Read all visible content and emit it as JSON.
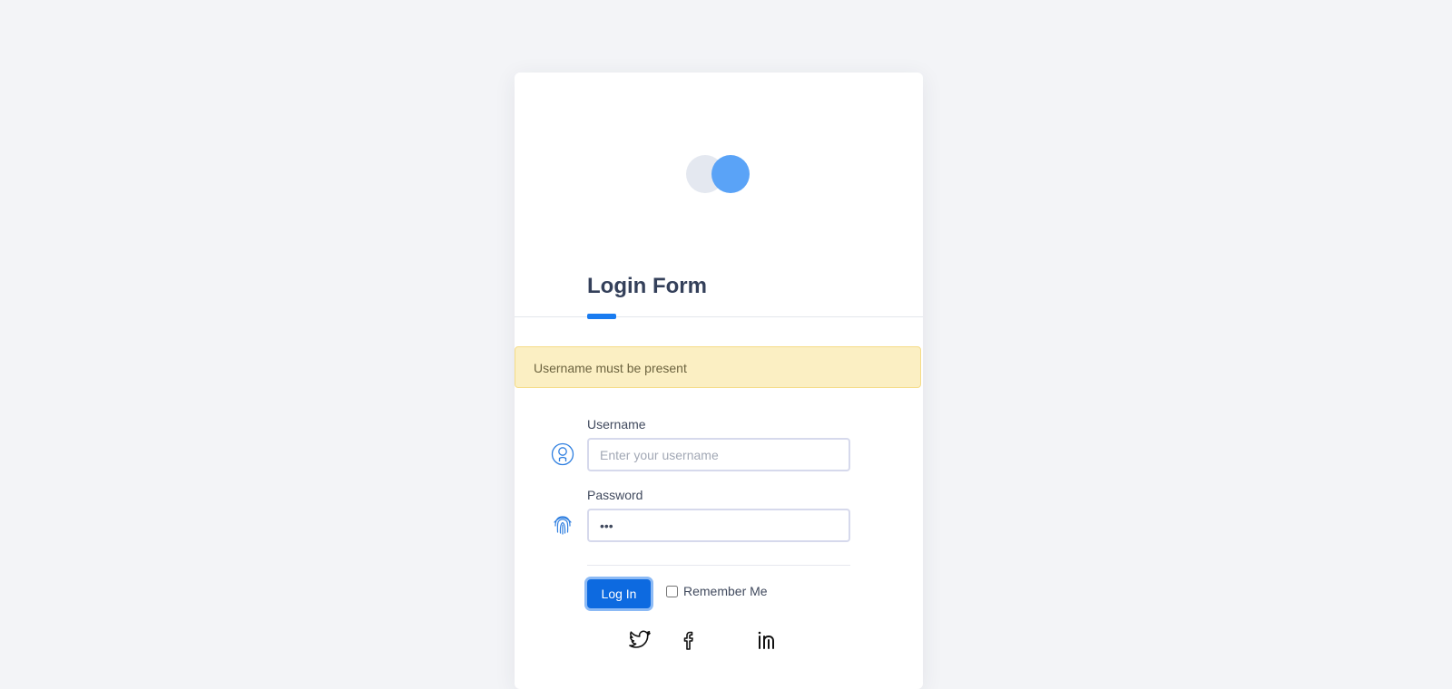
{
  "form": {
    "title": "Login Form",
    "alert": "Username must be present",
    "username": {
      "label": "Username",
      "placeholder": "Enter your username",
      "value": ""
    },
    "password": {
      "label": "Password",
      "value": "•••"
    },
    "login_button": "Log In",
    "remember_label": "Remember Me"
  },
  "icons": {
    "username": "user-icon",
    "password": "fingerprint-icon",
    "social": [
      "twitter-icon",
      "facebook-icon",
      "linkedin-icon"
    ]
  },
  "colors": {
    "accent": "#1a7cf0",
    "alert_bg": "#fbefc3",
    "logo_primary": "#5aa3f7",
    "logo_secondary": "#e4e8f0"
  }
}
